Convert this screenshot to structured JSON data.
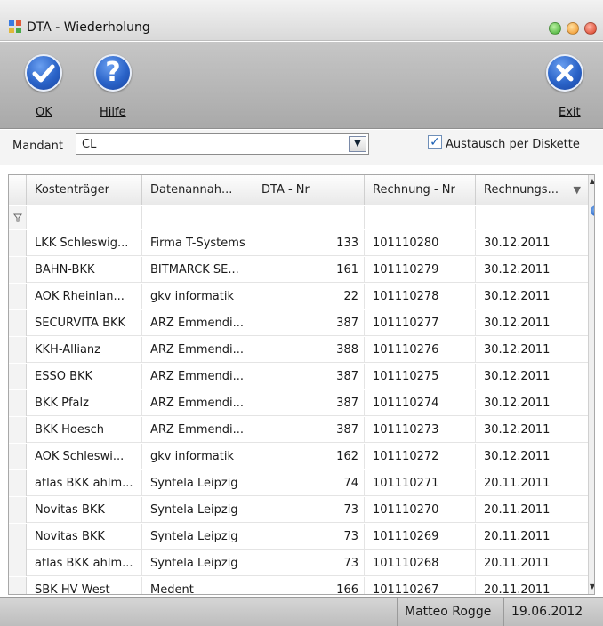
{
  "window": {
    "title": "DTA - Wiederholung",
    "controls": [
      "minimize",
      "maximize",
      "close"
    ]
  },
  "toolbar": {
    "ok_label": "OK",
    "help_label": "Hilfe",
    "exit_label": "Exit",
    "ok_icon": "check-icon",
    "help_icon": "question-icon",
    "exit_icon": "x-icon"
  },
  "mandant": {
    "label": "Mandant",
    "value": "CL"
  },
  "diskette": {
    "label": "Austausch per Diskette",
    "checked": true
  },
  "grid": {
    "columns": [
      "Kostenträger",
      "Datenannah...",
      "DTA - Nr",
      "Rechnung - Nr",
      "Rechnungs..."
    ],
    "rows": [
      [
        "LKK Schleswig...",
        "Firma T-Systems",
        "133",
        "101110280",
        "30.12.2011"
      ],
      [
        "BAHN-BKK",
        "BITMARCK SE...",
        "161",
        "101110279",
        "30.12.2011"
      ],
      [
        "AOK Rheinlan...",
        "gkv informatik",
        "22",
        "101110278",
        "30.12.2011"
      ],
      [
        "SECURVITA BKK",
        "ARZ Emmendi...",
        "387",
        "101110277",
        "30.12.2011"
      ],
      [
        "KKH-Allianz",
        "ARZ Emmendi...",
        "388",
        "101110276",
        "30.12.2011"
      ],
      [
        "ESSO BKK",
        "ARZ Emmendi...",
        "387",
        "101110275",
        "30.12.2011"
      ],
      [
        "BKK Pfalz",
        "ARZ Emmendi...",
        "387",
        "101110274",
        "30.12.2011"
      ],
      [
        "BKK Hoesch",
        "ARZ Emmendi...",
        "387",
        "101110273",
        "30.12.2011"
      ],
      [
        "AOK Schleswi...",
        "gkv informatik",
        "162",
        "101110272",
        "30.12.2011"
      ],
      [
        "atlas BKK ahlm...",
        "Syntela Leipzig",
        "74",
        "101110271",
        "20.11.2011"
      ],
      [
        "Novitas BKK",
        "Syntela Leipzig",
        "73",
        "101110270",
        "20.11.2011"
      ],
      [
        "Novitas BKK",
        "Syntela Leipzig",
        "73",
        "101110269",
        "20.11.2011"
      ],
      [
        "atlas BKK ahlm...",
        "Syntela Leipzig",
        "73",
        "101110268",
        "20.11.2011"
      ],
      [
        "SBK HV West",
        "Medent",
        "166",
        "101110267",
        "20.11.2011"
      ]
    ]
  },
  "status": {
    "user": "Matteo Rogge",
    "date": "19.06.2012"
  },
  "colors": {
    "accent": "#2a63c8",
    "toolbar": "#b5b5b5"
  }
}
